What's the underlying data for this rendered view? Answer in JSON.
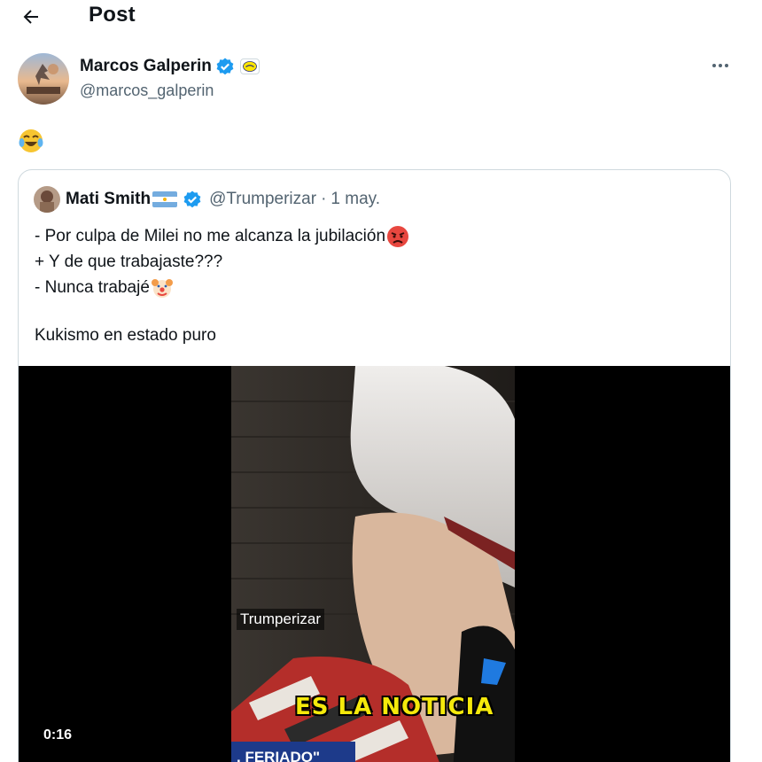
{
  "header": {
    "title": "Post",
    "back_icon": "arrow-left-icon"
  },
  "author": {
    "name": "Marcos Galperin",
    "handle": "@marcos_galperin",
    "verified_color": "#1d9bf0",
    "affiliate_icon": "mercadolibre-badge-icon",
    "more_icon": "more-horizontal-icon"
  },
  "post": {
    "text_emoji": "face-with-tears-of-joy-emoji"
  },
  "quote": {
    "name": "Mati Smith",
    "flag_icon": "argentina-flag-icon",
    "handle": "@Trumperizar",
    "separator": "·",
    "date": "1 may.",
    "lines": [
      {
        "text": "- Por culpa de Milei no me alcanza la jubilación",
        "emoji": "angry-face-emoji"
      },
      {
        "text": "+ Y de que trabajaste???",
        "emoji": ""
      },
      {
        "text": "- Nunca trabajé",
        "emoji": "clown-face-emoji"
      },
      {
        "text": "",
        "emoji": ""
      },
      {
        "text": "Kukismo en estado puro",
        "emoji": ""
      }
    ]
  },
  "media": {
    "watermark": "Trumperizar",
    "caption": "ES LA NOTICIA",
    "banner": ". FERIADO\"",
    "duration": "0:16"
  },
  "colors": {
    "text": "#0f1419",
    "secondary": "#536471",
    "border": "#cfd9de",
    "accent": "#1d9bf0"
  }
}
